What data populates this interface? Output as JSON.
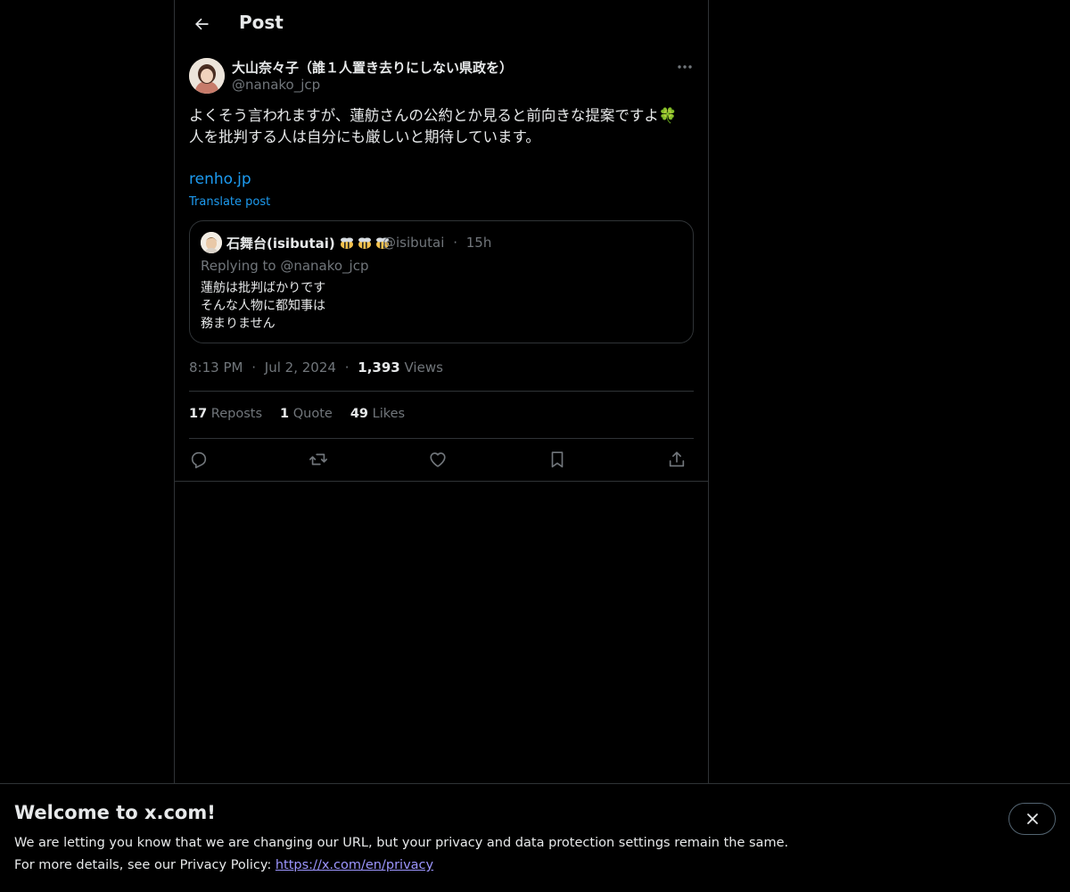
{
  "header": {
    "title": "Post"
  },
  "post": {
    "author_name": "大山奈々子（誰１人置き去りにしない県政を）",
    "author_handle": "@nanako_jcp",
    "text_line1": "よくそう言われますが、蓮舫さんの公約とか見ると前向きな提案ですよ🍀",
    "text_line2": "人を批判する人は自分にも厳しいと期待しています。",
    "link": "renho.jp",
    "translate": "Translate post",
    "quote": {
      "name": "石舞台(isibutai)",
      "handle": "@isibutai",
      "sep": "·",
      "time": "15h",
      "replying": "Replying to @nanako_jcp",
      "line1": "蓮舫は批判ばかりです",
      "line2": "そんな人物に都知事は",
      "line3": "務まりません"
    },
    "time": "8:13 PM",
    "dot1": "·",
    "date": "Jul 2, 2024",
    "dot2": "·",
    "views_count": "1,393",
    "views_label": "Views",
    "reposts_count": "17",
    "reposts_label": "Reposts",
    "quotes_count": "1",
    "quotes_label": "Quote",
    "likes_count": "49",
    "likes_label": "Likes"
  },
  "icons": [
    "back-arrow-icon",
    "more-icon",
    "reply-icon",
    "repost-icon",
    "like-icon",
    "bookmark-icon",
    "share-icon",
    "close-icon",
    "bee-icon"
  ],
  "colors": {
    "accent": "#1d9bf0",
    "muted": "#71767b",
    "border": "#2f3336",
    "text": "#e7e9ea"
  },
  "banner": {
    "title": "Welcome to x.com!",
    "line1": "We are letting you know that we are changing our URL, but your privacy and data protection settings remain the same.",
    "line2_prefix": "For more details, see our Privacy Policy: ",
    "link": "https://x.com/en/privacy"
  }
}
